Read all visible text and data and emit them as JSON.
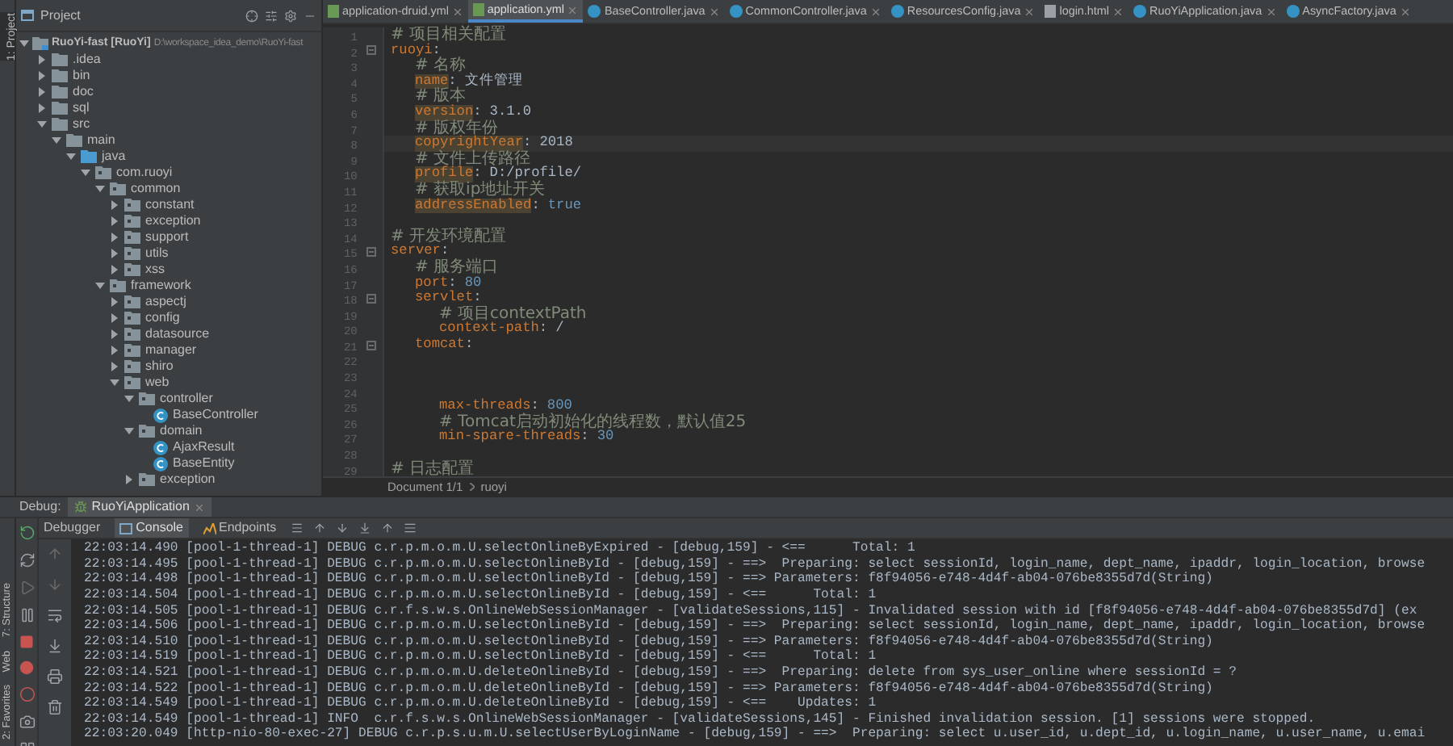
{
  "side_strip": {
    "project_tab": "1: Project"
  },
  "project": {
    "title": "Project",
    "tree": [
      {
        "label": "RuoYi-fast [RuoYi]",
        "path": "D:\\workspace_idea_demo\\RuoYi-fast",
        "kind": "module",
        "expanded": true,
        "children": [
          {
            "label": ".idea",
            "kind": "folder",
            "expanded": false
          },
          {
            "label": "bin",
            "kind": "folder",
            "expanded": false
          },
          {
            "label": "doc",
            "kind": "folder",
            "expanded": false
          },
          {
            "label": "sql",
            "kind": "folder",
            "expanded": false
          },
          {
            "label": "src",
            "kind": "folder",
            "expanded": true,
            "children": [
              {
                "label": "main",
                "kind": "folder",
                "expanded": true,
                "children": [
                  {
                    "label": "java",
                    "kind": "source",
                    "expanded": true,
                    "children": [
                      {
                        "label": "com.ruoyi",
                        "kind": "package",
                        "expanded": true,
                        "children": [
                          {
                            "label": "common",
                            "kind": "package",
                            "expanded": true,
                            "children": [
                              {
                                "label": "constant",
                                "kind": "package",
                                "expanded": false
                              },
                              {
                                "label": "exception",
                                "kind": "package",
                                "expanded": false
                              },
                              {
                                "label": "support",
                                "kind": "package",
                                "expanded": false
                              },
                              {
                                "label": "utils",
                                "kind": "package",
                                "expanded": false
                              },
                              {
                                "label": "xss",
                                "kind": "package",
                                "expanded": false
                              }
                            ]
                          },
                          {
                            "label": "framework",
                            "kind": "package",
                            "expanded": true,
                            "children": [
                              {
                                "label": "aspectj",
                                "kind": "package",
                                "expanded": false
                              },
                              {
                                "label": "config",
                                "kind": "package",
                                "expanded": false
                              },
                              {
                                "label": "datasource",
                                "kind": "package",
                                "expanded": false
                              },
                              {
                                "label": "manager",
                                "kind": "package",
                                "expanded": false
                              },
                              {
                                "label": "shiro",
                                "kind": "package",
                                "expanded": false
                              },
                              {
                                "label": "web",
                                "kind": "package",
                                "expanded": true,
                                "children": [
                                  {
                                    "label": "controller",
                                    "kind": "package",
                                    "expanded": true,
                                    "children": [
                                      {
                                        "label": "BaseController",
                                        "kind": "class"
                                      }
                                    ]
                                  },
                                  {
                                    "label": "domain",
                                    "kind": "package",
                                    "expanded": true,
                                    "children": [
                                      {
                                        "label": "AjaxResult",
                                        "kind": "class"
                                      },
                                      {
                                        "label": "BaseEntity",
                                        "kind": "class"
                                      }
                                    ]
                                  },
                                  {
                                    "label": "exception",
                                    "kind": "package",
                                    "expanded": false
                                  }
                                ]
                              }
                            ]
                          }
                        ]
                      }
                    ]
                  }
                ]
              }
            ]
          }
        ]
      }
    ]
  },
  "editor": {
    "tabs": [
      {
        "label": "application-druid.yml",
        "kind": "yml",
        "selected": false
      },
      {
        "label": "application.yml",
        "kind": "yml",
        "selected": true
      },
      {
        "label": "BaseController.java",
        "kind": "class",
        "selected": false
      },
      {
        "label": "CommonController.java",
        "kind": "class",
        "selected": false
      },
      {
        "label": "ResourcesConfig.java",
        "kind": "class",
        "selected": false
      },
      {
        "label": "login.html",
        "kind": "html",
        "selected": false
      },
      {
        "label": "RuoYiApplication.java",
        "kind": "class",
        "selected": false
      },
      {
        "label": "AsyncFactory.java",
        "kind": "class",
        "selected": false
      }
    ],
    "lines": [
      {
        "number": "1",
        "parts": [
          {
            "kind": "comment",
            "text": "# 项目相关配置"
          }
        ]
      },
      {
        "number": "2",
        "parts": [
          {
            "kind": "key",
            "text": "ruoyi"
          },
          {
            "kind": "punct",
            "text": ":"
          }
        ],
        "children": [
          {
            "number": "3",
            "parts": [
              {
                "kind": "comment",
                "text": "# 名称"
              }
            ]
          },
          {
            "number": "4",
            "parts": [
              {
                "kind": "key",
                "text": "name",
                "marked": true
              },
              {
                "kind": "punct",
                "text": ":"
              },
              {
                "kind": "value",
                "text": "文件管理"
              }
            ]
          },
          {
            "number": "5",
            "parts": [
              {
                "kind": "comment",
                "text": "# 版本"
              }
            ]
          },
          {
            "number": "6",
            "parts": [
              {
                "kind": "key",
                "text": "version",
                "marked": true
              },
              {
                "kind": "punct",
                "text": ":"
              },
              {
                "kind": "value",
                "text": "3.1.0"
              }
            ]
          },
          {
            "number": "7",
            "parts": [
              {
                "kind": "comment",
                "text": "# 版权年份"
              }
            ]
          },
          {
            "number": "8",
            "caret": true,
            "parts": [
              {
                "kind": "key",
                "text": "copyrightYear",
                "marked": true
              },
              {
                "kind": "punct",
                "text": ":"
              },
              {
                "kind": "value",
                "text": "2018"
              }
            ]
          },
          {
            "number": "9",
            "parts": [
              {
                "kind": "comment",
                "text": "# 文件上传路径"
              }
            ]
          },
          {
            "number": "10",
            "parts": [
              {
                "kind": "key",
                "text": "profile",
                "marked": true
              },
              {
                "kind": "punct",
                "text": ":"
              },
              {
                "kind": "value",
                "text": "D:/profile/"
              }
            ]
          },
          {
            "number": "11",
            "parts": [
              {
                "kind": "comment",
                "text": "# 获取ip地址开关"
              }
            ]
          },
          {
            "number": "12",
            "parts": [
              {
                "kind": "key",
                "text": "addressEnabled",
                "marked": true
              },
              {
                "kind": "punct",
                "text": ":"
              },
              {
                "kind": "number",
                "text": "true"
              }
            ]
          }
        ]
      },
      {
        "number": "13"
      },
      {
        "number": "14",
        "parts": [
          {
            "kind": "comment",
            "text": "# 开发环境配置"
          }
        ]
      },
      {
        "number": "15",
        "parts": [
          {
            "kind": "key",
            "text": "server"
          },
          {
            "kind": "punct",
            "text": ":"
          }
        ],
        "children": [
          {
            "number": "16",
            "parts": [
              {
                "kind": "comment",
                "text": "# 服务端口"
              }
            ]
          },
          {
            "number": "17",
            "parts": [
              {
                "kind": "key",
                "text": "port"
              },
              {
                "kind": "punct",
                "text": ":"
              },
              {
                "kind": "number",
                "text": "80"
              }
            ]
          },
          {
            "number": "18",
            "parts": [
              {
                "kind": "key",
                "text": "servlet"
              },
              {
                "kind": "punct",
                "text": ":"
              }
            ],
            "children": [
              {
                "number": "19",
                "parts": [
                  {
                    "kind": "comment",
                    "text": "# 项目contextPath"
                  }
                ]
              },
              {
                "number": "20",
                "parts": [
                  {
                    "kind": "key",
                    "text": "context-path"
                  },
                  {
                    "kind": "punct",
                    "text": ":"
                  },
                  {
                    "kind": "value",
                    "text": "/"
                  }
                ]
              }
            ]
          },
          {
            "number": "21",
            "parts": [
              {
                "kind": "key",
                "text": "tomcat"
              },
              {
                "kind": "punct",
                "text": ":"
              }
            ],
            "children": [
              {
                "number": "22"
              },
              {
                "number": "23"
              },
              {
                "number": "24"
              },
              {
                "number": "25",
                "parts": [
                  {
                    "kind": "key",
                    "text": "max-threads"
                  },
                  {
                    "kind": "punct",
                    "text": ":"
                  },
                  {
                    "kind": "number",
                    "text": "800"
                  }
                ]
              },
              {
                "number": "26",
                "parts": [
                  {
                    "kind": "comment",
                    "text": "# Tomcat启动初始化的线程数，默认值25"
                  }
                ]
              },
              {
                "number": "27",
                "parts": [
                  {
                    "kind": "key",
                    "text": "min-spare-threads"
                  },
                  {
                    "kind": "punct",
                    "text": ":"
                  },
                  {
                    "kind": "number",
                    "text": "30"
                  }
                ]
              }
            ]
          }
        ]
      },
      {
        "number": "28"
      },
      {
        "number": "29",
        "parts": [
          {
            "kind": "comment",
            "text": "# 日志配置"
          }
        ]
      }
    ],
    "breadcrumb": [
      "Document 1/1",
      "ruoyi"
    ]
  },
  "debug": {
    "label": "Debug:",
    "session": "RuoYiApplication",
    "tabs": [
      {
        "label": "Debugger",
        "kind": "plain",
        "selected": false
      },
      {
        "label": "Console",
        "kind": "console",
        "selected": true
      },
      {
        "label": "Endpoints",
        "kind": "endpoints",
        "selected": false
      }
    ],
    "side_tabs": [
      "7: Structure",
      "Web",
      "2: Favorites"
    ],
    "console": [
      "22:03:14.490 [pool-1-thread-1] DEBUG c.r.p.m.o.m.U.selectOnlineByExpired - [debug,159] - <==      Total: 1",
      "22:03:14.495 [pool-1-thread-1] DEBUG c.r.p.m.o.m.U.selectOnlineById - [debug,159] - ==>  Preparing: select sessionId, login_name, dept_name, ipaddr, login_location, browse",
      "22:03:14.498 [pool-1-thread-1] DEBUG c.r.p.m.o.m.U.selectOnlineById - [debug,159] - ==> Parameters: f8f94056-e748-4d4f-ab04-076be8355d7d(String)",
      "22:03:14.504 [pool-1-thread-1] DEBUG c.r.p.m.o.m.U.selectOnlineById - [debug,159] - <==      Total: 1",
      "22:03:14.505 [pool-1-thread-1] DEBUG c.r.f.s.w.s.OnlineWebSessionManager - [validateSessions,115] - Invalidated session with id [f8f94056-e748-4d4f-ab04-076be8355d7d] (ex",
      "22:03:14.506 [pool-1-thread-1] DEBUG c.r.p.m.o.m.U.selectOnlineById - [debug,159] - ==>  Preparing: select sessionId, login_name, dept_name, ipaddr, login_location, browse",
      "22:03:14.510 [pool-1-thread-1] DEBUG c.r.p.m.o.m.U.selectOnlineById - [debug,159] - ==> Parameters: f8f94056-e748-4d4f-ab04-076be8355d7d(String)",
      "22:03:14.519 [pool-1-thread-1] DEBUG c.r.p.m.o.m.U.selectOnlineById - [debug,159] - <==      Total: 1",
      "22:03:14.521 [pool-1-thread-1] DEBUG c.r.p.m.o.m.U.deleteOnlineById - [debug,159] - ==>  Preparing: delete from sys_user_online where sessionId = ?",
      "22:03:14.522 [pool-1-thread-1] DEBUG c.r.p.m.o.m.U.deleteOnlineById - [debug,159] - ==> Parameters: f8f94056-e748-4d4f-ab04-076be8355d7d(String)",
      "22:03:14.549 [pool-1-thread-1] DEBUG c.r.p.m.o.m.U.deleteOnlineById - [debug,159] - <==    Updates: 1",
      "22:03:14.549 [pool-1-thread-1] INFO  c.r.f.s.w.s.OnlineWebSessionManager - [validateSessions,145] - Finished invalidation session. [1] sessions were stopped.",
      "22:03:20.049 [http-nio-80-exec-27] DEBUG c.r.p.s.u.m.U.selectUserByLoginName - [debug,159] - ==>  Preparing: select u.user_id, u.dept_id, u.login_name, u.user_name, u.emai"
    ]
  }
}
